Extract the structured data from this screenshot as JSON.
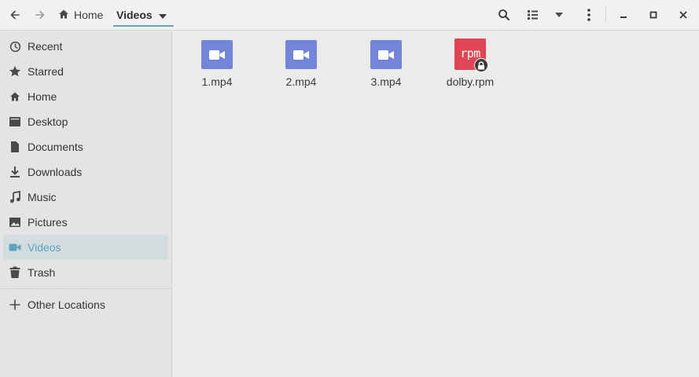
{
  "header": {
    "back_icon": "arrow-left-icon",
    "forward_icon": "arrow-right-icon",
    "breadcrumb": [
      {
        "label": "Home",
        "icon": "home-icon"
      },
      {
        "label": "Videos",
        "icon": "chevron-down-icon",
        "active": true
      }
    ],
    "toolbar_icons": [
      "search-icon",
      "list-view-icon",
      "view-options-dropdown-icon",
      "menu-icon"
    ],
    "window_controls": [
      "minimize-icon",
      "maximize-icon",
      "close-icon"
    ]
  },
  "sidebar": {
    "items": [
      {
        "label": "Recent",
        "icon": "clock-icon"
      },
      {
        "label": "Starred",
        "icon": "star-icon"
      },
      {
        "label": "Home",
        "icon": "home-icon"
      },
      {
        "label": "Desktop",
        "icon": "desktop-icon"
      },
      {
        "label": "Documents",
        "icon": "document-icon"
      },
      {
        "label": "Downloads",
        "icon": "download-icon"
      },
      {
        "label": "Music",
        "icon": "music-icon"
      },
      {
        "label": "Pictures",
        "icon": "picture-icon"
      },
      {
        "label": "Videos",
        "icon": "video-icon",
        "active": true
      },
      {
        "label": "Trash",
        "icon": "trash-icon"
      }
    ],
    "other": {
      "label": "Other Locations",
      "icon": "plus-icon"
    }
  },
  "files": [
    {
      "name": "1.mp4",
      "icon": "video-file-icon"
    },
    {
      "name": "2.mp4",
      "icon": "video-file-icon"
    },
    {
      "name": "3.mp4",
      "icon": "video-file-icon"
    },
    {
      "name": "dolby.rpm",
      "icon": "rpm-package-icon",
      "badge_text": "rpm",
      "locked": true
    }
  ],
  "colors": {
    "accent": "#5ba4bd",
    "video_icon": "#7285d8",
    "rpm_icon": "#e04554"
  }
}
